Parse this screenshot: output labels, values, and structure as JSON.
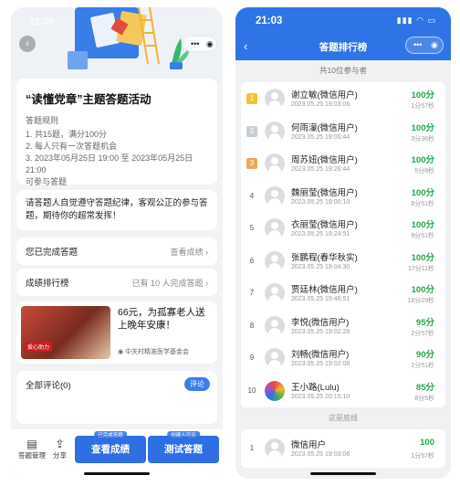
{
  "left": {
    "status_time": "21:00",
    "title": "“读懂党章”主题答题活动",
    "rules_heading": "答题规则",
    "rules": [
      "1. 共15题，满分100分",
      "2. 每人只有一次答题机会",
      "3. 2023年05月25日 19:00 至 2023年05月25日 21:00",
      "可参与答题"
    ],
    "notice": "请答题人自觉遵守答题纪律，客观公正的参与答题，期待你的超常发挥！",
    "completed": {
      "label": "您已完成答题",
      "action": "查看成绩"
    },
    "ranking": {
      "label": "成绩排行榜",
      "action": "已有 10 人完成答题"
    },
    "ad": {
      "text": "66元，为孤寡老人送上晚年安康！",
      "source": "中关村精准医学基金会",
      "image_tag": "爱心助力"
    },
    "comments": {
      "label": "全部评论(0)",
      "button": "评论"
    },
    "bottom": {
      "manage": "答题管理",
      "share": "分享",
      "view_btn_small": "已完成答题",
      "view_btn": "查看成绩",
      "test_btn_small": "创建人可见",
      "test_btn": "测试答题"
    }
  },
  "right": {
    "status_time": "21:03",
    "title": "答题排行榜",
    "total": "共10位参与者",
    "ranking": [
      {
        "rank": "1",
        "name": "谢立敏(微信用户)",
        "date": "2023.05.25 19:03:06",
        "score": "100分",
        "dur": "1分57秒"
      },
      {
        "rank": "2",
        "name": "何雨濛(微信用户)",
        "date": "2023.05.25 19:05:44",
        "score": "100分",
        "dur": "3分36秒"
      },
      {
        "rank": "3",
        "name": "周苏妞(微信用户)",
        "date": "2023.05.25 19:26:44",
        "score": "100分",
        "dur": "5分8秒"
      },
      {
        "rank": "4",
        "name": "魏丽莹(微信用户)",
        "date": "2023.05.25 19:00:10",
        "score": "100分",
        "dur": "6分51秒"
      },
      {
        "rank": "5",
        "name": "衣丽莹(微信用户)",
        "date": "2023.05.25 19:24:51",
        "score": "100分",
        "dur": "9分51秒"
      },
      {
        "rank": "6",
        "name": "张鹏程(春华秋实)",
        "date": "2023.05.25 19:04:30",
        "score": "100分",
        "dur": "17分11秒"
      },
      {
        "rank": "7",
        "name": "贾廷林(微信用户)",
        "date": "2023.05.25 19:46:51",
        "score": "100分",
        "dur": "18分29秒"
      },
      {
        "rank": "8",
        "name": "李悦(微信用户)",
        "date": "2023.05.25 19:02:28",
        "score": "95分",
        "dur": "2分57秒"
      },
      {
        "rank": "9",
        "name": "刘畅(微信用户)",
        "date": "2023.05.25 19:02:08",
        "score": "90分",
        "dur": "1分51秒"
      },
      {
        "rank": "10",
        "name": "王小路(Lulu)",
        "date": "2023.05.25 20:15:10",
        "score": "85分",
        "dur": "8分5秒"
      }
    ],
    "separator": "这是底线",
    "mine": {
      "rank": "1",
      "name": "微信用户",
      "date": "2023.05.25 19:03:06",
      "score": "100",
      "dur": "1分57秒"
    }
  },
  "colors": {
    "accent": "#2e74e6",
    "score_green": "#22a84a"
  }
}
